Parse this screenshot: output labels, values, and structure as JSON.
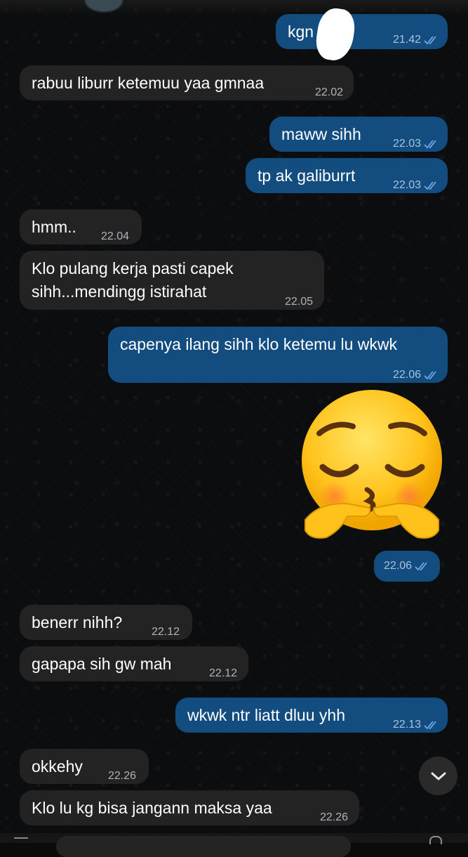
{
  "chat": {
    "messages": [
      {
        "id": "m1",
        "dir": "out",
        "text": "kgn    ih",
        "time": "21.42",
        "read": true
      },
      {
        "id": "m2",
        "dir": "in",
        "text": "rabuu liburr ketemuu yaa gmnaa",
        "time": "22.02"
      },
      {
        "id": "m3",
        "dir": "out",
        "text": "maww sihh",
        "time": "22.03",
        "read": true
      },
      {
        "id": "m4",
        "dir": "out",
        "text": "tp ak galiburrt",
        "time": "22.03",
        "read": true
      },
      {
        "id": "m5",
        "dir": "in",
        "text": "hmm..",
        "time": "22.04"
      },
      {
        "id": "m6",
        "dir": "in",
        "line1": "Klo pulang kerja pasti capek",
        "line2": "sihh...mendingg istirahat",
        "time": "22.05"
      },
      {
        "id": "m7",
        "dir": "out",
        "text": "capenya ilang sihh klo ketemu lu wkwk",
        "time": "22.06",
        "read": true
      },
      {
        "id": "m8",
        "dir": "out",
        "type": "sticker",
        "sticker": "pensive-kiss-emoji",
        "time": "22.06",
        "read": true
      },
      {
        "id": "m9",
        "dir": "in",
        "text": "benerr nihh?",
        "time": "22.12"
      },
      {
        "id": "m10",
        "dir": "in",
        "text": "gapapa sih gw mah",
        "time": "22.12"
      },
      {
        "id": "m11",
        "dir": "out",
        "text": "wkwk ntr liatt dluu yhh",
        "time": "22.13",
        "read": true
      },
      {
        "id": "m12",
        "dir": "in",
        "text": "okkehy",
        "time": "22.26"
      },
      {
        "id": "m13",
        "dir": "in",
        "text": "Klo lu kg bisa jangann maksa yaa",
        "time": "22.26"
      }
    ]
  },
  "icons": {
    "read_receipt": "double-check-icon",
    "scroll_down": "chevron-down-icon"
  },
  "colors": {
    "outgoing_bubble": "#134d80",
    "incoming_bubble": "#232323",
    "read_tick": "#6fa7e8",
    "background": "#0c0d0e"
  }
}
